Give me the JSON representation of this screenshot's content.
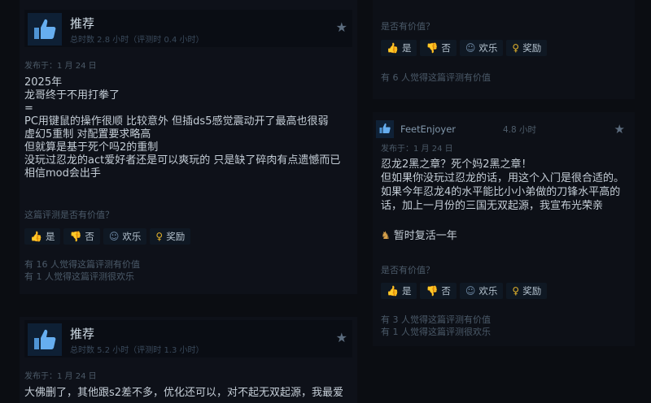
{
  "review1": {
    "verdict": "推荐",
    "hours": "总时数 2.8 小时（评测时 0.4 小时）",
    "posted": "发布于：1 月 24 日",
    "body": "2025年\n龙哥终于不用打拳了\n=\nPC用键鼠的操作很顺 比较意外 但插ds5感觉震动开了最高也很弱\n虚幻5重制 对配置要求略高\n但就算是基于死个吗2的重制\n没玩过忍龙的act爱好者还是可以爽玩的 只是缺了碎肉有点遗憾而已\n相信mod会出手",
    "helpful_q": "这篇评测是否有价值？",
    "votes": [
      "是",
      "否",
      "欢乐",
      "奖励"
    ],
    "stats": [
      "有 16 人觉得这篇评测有价值",
      "有 1 人觉得这篇评测很欢乐"
    ]
  },
  "review2": {
    "verdict": "推荐",
    "hours": "总时数 5.2 小时（评测时 1.3 小时）",
    "posted": "发布于：1 月 24 日",
    "body": "大佛删了，其他跟s2差不多，优化还可以，对不起无双起源，我最爱"
  },
  "review3": {
    "helpful_q": "是否有价值？",
    "votes": [
      "是",
      "否",
      "欢乐",
      "奖励"
    ],
    "stats": [
      "有 6 人觉得这篇评测有价值"
    ]
  },
  "review4": {
    "username": "FeetEnjoyer",
    "hours": "4.8 小时",
    "posted": "发布于：1 月 24 日",
    "body": "忍龙2黑之章？死个妈2黑之章！\n但如果你没玩过忍龙的话，用这个入门是很合适的。\n如果今年忍龙4的水平能比小小弟做的刀锋水平高的话，加上一月份的三国无双起源，我宣布光荣亲",
    "body_tail": "暂时复活一年",
    "helpful_q": "是否有价值？",
    "votes": [
      "是",
      "否",
      "欢乐",
      "奖励"
    ],
    "stats": [
      "有 3 人觉得这篇评测有价值",
      "有 1 人觉得这篇评测很欢乐"
    ]
  }
}
